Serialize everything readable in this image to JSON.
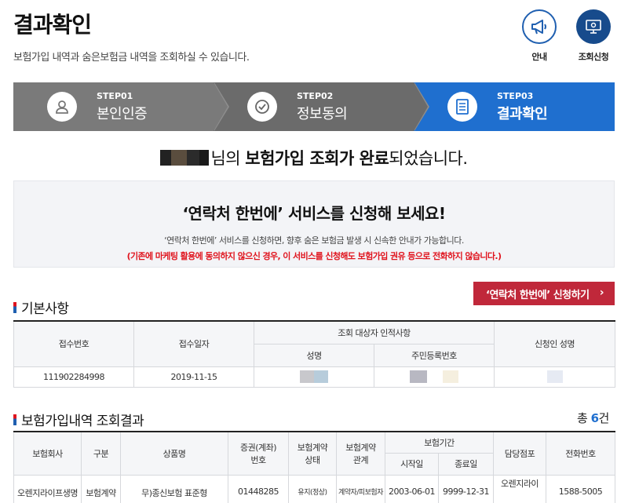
{
  "page": {
    "title": "결과확인",
    "desc": "보험가입 내역과 숨은보험금 내역을 조회하실 수 있습니다."
  },
  "top_buttons": {
    "guide": {
      "label": "안내",
      "icon": "megaphone-icon"
    },
    "request": {
      "label": "조회신청",
      "icon": "monitor-icon"
    }
  },
  "steps": [
    {
      "num": "STEP01",
      "name": "본인인증",
      "icon": "user-icon"
    },
    {
      "num": "STEP02",
      "name": "정보동의",
      "icon": "check-circle-icon"
    },
    {
      "num": "STEP03",
      "name": "결과확인",
      "icon": "document-icon"
    }
  ],
  "complete": {
    "suffix1": "님의 ",
    "bold": "보험가입 조회가 완료",
    "suffix2": "되었습니다."
  },
  "promo": {
    "title": "‘연락처 한번에’ 서비스를 신청해 보세요!",
    "desc": "‘연락처 한번에’ 서비스를 신청하면, 향후 숨은 보험금 발생 시 신속한 안내가 가능합니다.",
    "warning": "(기존에 마케팅 활용에 동의하지 않으신 경우, 이 서비스를 신청해도 보험가입 권유 등으로 전화하지 않습니다.)"
  },
  "apply_button": {
    "label": "‘연락처 한번에’ 신청하기",
    "chevron": "›"
  },
  "basic": {
    "title": "기본사항",
    "headers": {
      "receipt_no": "접수번호",
      "receipt_date": "접수일자",
      "target_group": "조회 대상자 인적사항",
      "name": "성명",
      "resident_no": "주민등록번호",
      "applicant": "신청인 성명"
    },
    "row": {
      "receipt_no": "111902284998",
      "receipt_date": "2019-11-15"
    }
  },
  "insurance": {
    "title": "보험가입내역 조회결과",
    "total_prefix": "총 ",
    "total_count": "6",
    "total_suffix": "건",
    "headers": {
      "company": "보험회사",
      "category": "구분",
      "product": "상품명",
      "policy_a": "증권(계좌)",
      "policy_b": "번호",
      "contract_status_a": "보험계약",
      "contract_status_b": "상태",
      "contract_rel_a": "보험계약",
      "contract_rel_b": "관계",
      "period": "보험기간",
      "start": "시작일",
      "end": "종료일",
      "branch": "담당점포",
      "phone": "전화번호"
    },
    "rows": [
      {
        "company": "오렌지라이프생명",
        "category": "보험계약",
        "product": "무)종신보험 표준형",
        "policy": "01448285",
        "status": "유지(정상)",
        "relation": "계약자/피보험자",
        "start": "2003-06-01",
        "end": "9999-12-31",
        "branch": "오렌지라이",
        "phone": "1588-5005"
      }
    ]
  }
}
